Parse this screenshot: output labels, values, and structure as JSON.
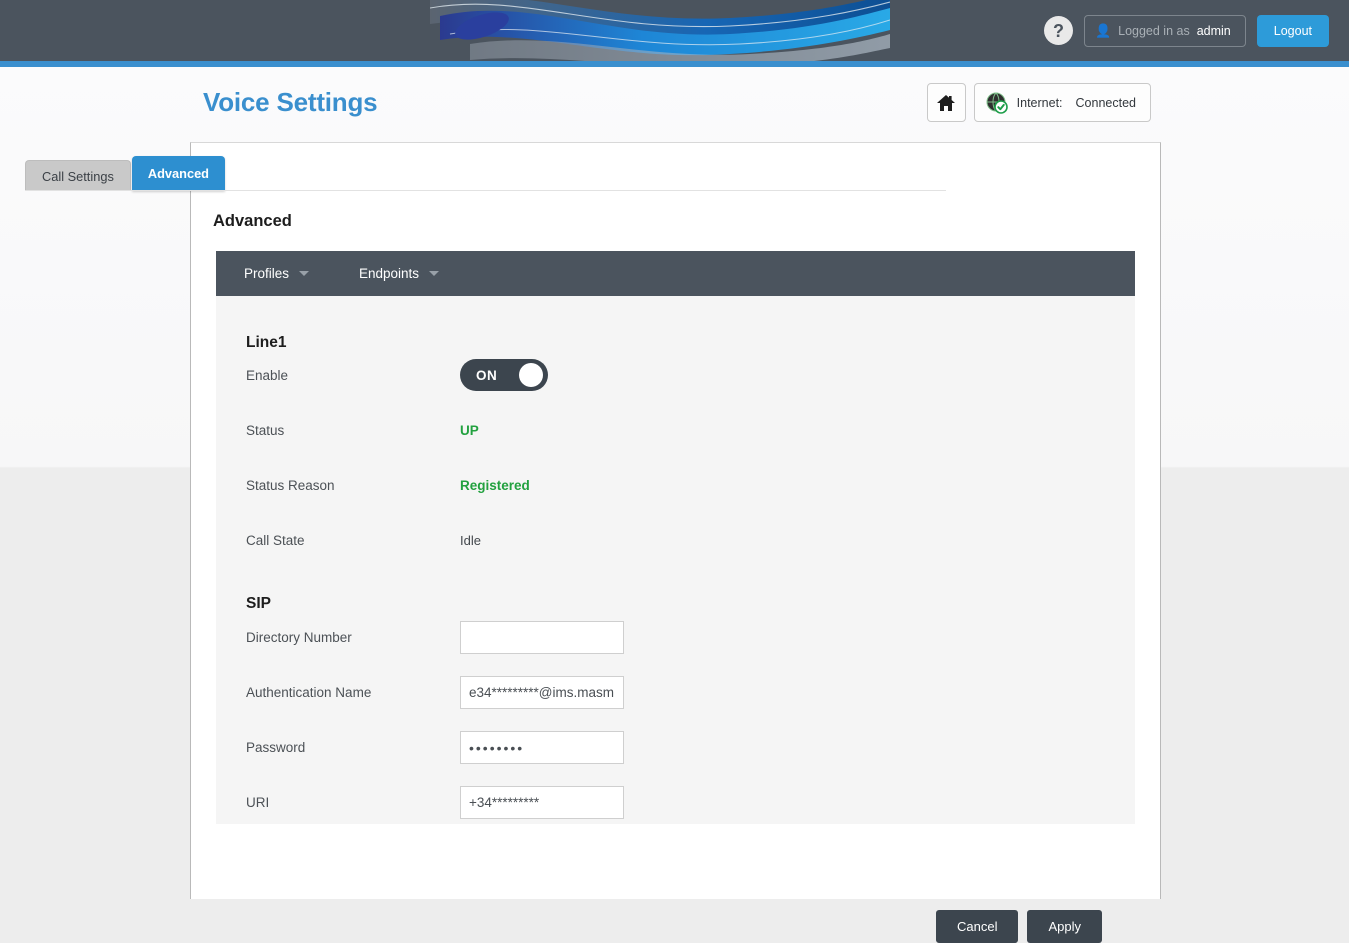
{
  "header": {
    "help_icon": "question-mark-icon",
    "user_icon": "user-icon",
    "logged_in_label": "Logged in as",
    "username": "admin",
    "logout_label": "Logout",
    "bar_color": "#4b545e",
    "stripe_color": "#3a8fce"
  },
  "page": {
    "title": "Voice Settings",
    "title_color": "#3a8fce",
    "home_icon": "home-icon",
    "internet_icon": "globe-check-icon",
    "internet_label": "Internet:",
    "internet_value": "Connected"
  },
  "tabs": [
    {
      "label": "Call Settings",
      "active": false
    },
    {
      "label": "Advanced",
      "active": true
    }
  ],
  "section": {
    "title": "Advanced"
  },
  "navbar": {
    "items": [
      {
        "label": "Profiles",
        "caret": "chevron-down-icon"
      },
      {
        "label": "Endpoints",
        "caret": "chevron-down-icon"
      }
    ]
  },
  "line1": {
    "heading": "Line1",
    "enable_label": "Enable",
    "enable_state": "ON",
    "status_label": "Status",
    "status_value": "UP",
    "status_reason_label": "Status Reason",
    "status_reason_value": "Registered",
    "call_state_label": "Call State",
    "call_state_value": "Idle",
    "status_color": "#22a13f"
  },
  "sip": {
    "heading": "SIP",
    "directory_number_label": "Directory Number",
    "directory_number_value": "",
    "directory_number_placeholder": "",
    "auth_name_label": "Authentication Name",
    "auth_name_value": "e34*********@ims.masm",
    "password_label": "Password",
    "password_value": "••••••••",
    "uri_label": "URI",
    "uri_value": "+34*********"
  },
  "actions": {
    "cancel_label": "Cancel",
    "apply_label": "Apply",
    "button_color": "#3c454e"
  }
}
